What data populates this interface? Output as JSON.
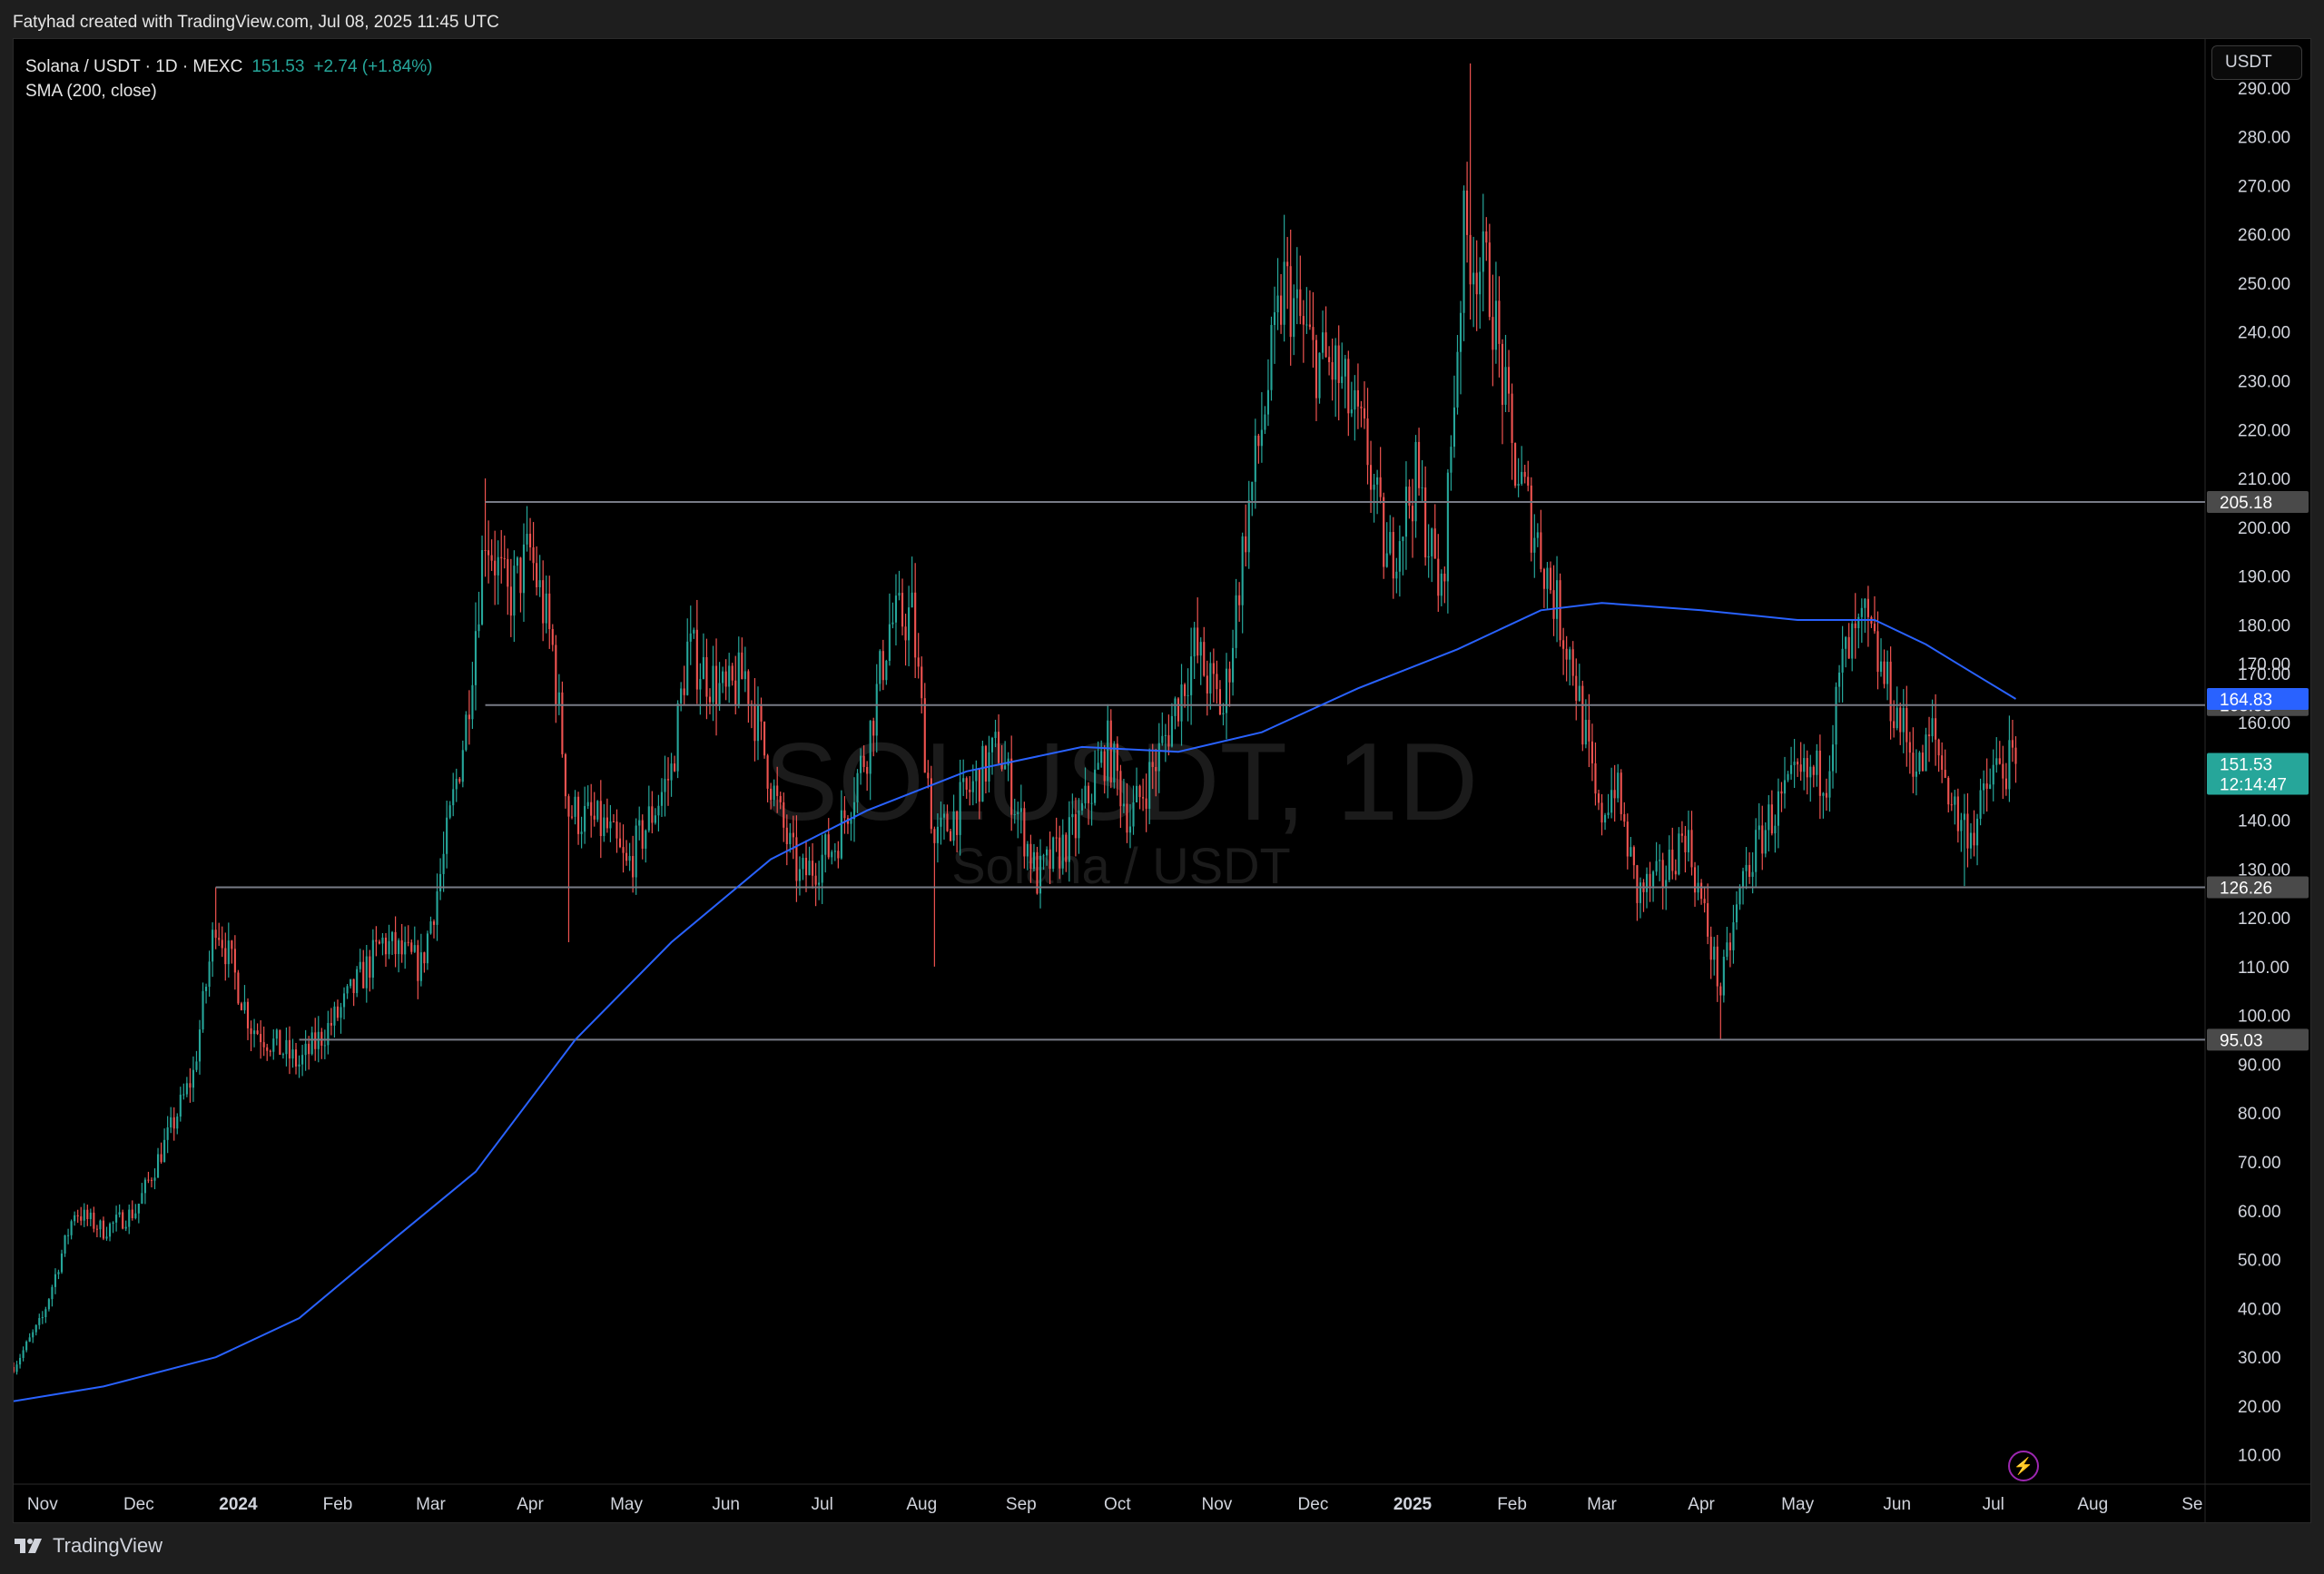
{
  "header": {
    "attribution": "Fatyhad created with TradingView.com, Jul 08, 2025 11:45 UTC"
  },
  "legend": {
    "symbol_line": "Solana / USDT · 1D · MEXC",
    "price": "151.53",
    "change": "+2.74 (+1.84%)",
    "indicator": "SMA (200, close)"
  },
  "toolbar": {
    "currency": "USDT"
  },
  "footer": {
    "brand": "TradingView"
  },
  "icons": {
    "flash": "lightning-icon",
    "logo": "tradingview-logo-icon"
  },
  "colors": {
    "up": "#26a69a",
    "down": "#ef5350",
    "sma": "#2962ff",
    "level": "#787b86",
    "price_badge": "#26a69a",
    "sma_badge": "#2962ff",
    "level_badge": "#4a4a4a"
  },
  "chart_data": {
    "type": "candlestick",
    "title": "Solana / USDT · 1D · MEXC",
    "watermark": {
      "title": "SOLUSDT, 1D",
      "subtitle": "Solana / USDT"
    },
    "x_range": [
      "2023-10-23",
      "2025-09-05"
    ],
    "y_range": [
      4,
      300
    ],
    "y_ticks": [
      10,
      20,
      30,
      40,
      50,
      60,
      70,
      80,
      90,
      100,
      110,
      120,
      130,
      140,
      150,
      160,
      170,
      180,
      190,
      200,
      210,
      220,
      230,
      240,
      250,
      260,
      270,
      280,
      290
    ],
    "x_ticks": [
      {
        "label": "Nov",
        "date": "2023-11-01",
        "bold": false
      },
      {
        "label": "Dec",
        "date": "2023-12-01",
        "bold": false
      },
      {
        "label": "2024",
        "date": "2024-01-01",
        "bold": true
      },
      {
        "label": "Feb",
        "date": "2024-02-01",
        "bold": false
      },
      {
        "label": "Mar",
        "date": "2024-03-01",
        "bold": false
      },
      {
        "label": "Apr",
        "date": "2024-04-01",
        "bold": false
      },
      {
        "label": "May",
        "date": "2024-05-01",
        "bold": false
      },
      {
        "label": "Jun",
        "date": "2024-06-01",
        "bold": false
      },
      {
        "label": "Jul",
        "date": "2024-07-01",
        "bold": false
      },
      {
        "label": "Aug",
        "date": "2024-08-01",
        "bold": false
      },
      {
        "label": "Sep",
        "date": "2024-09-01",
        "bold": false
      },
      {
        "label": "Oct",
        "date": "2024-10-01",
        "bold": false
      },
      {
        "label": "Nov",
        "date": "2024-11-01",
        "bold": false
      },
      {
        "label": "Dec",
        "date": "2024-12-01",
        "bold": false
      },
      {
        "label": "2025",
        "date": "2025-01-01",
        "bold": true
      },
      {
        "label": "Feb",
        "date": "2025-02-01",
        "bold": false
      },
      {
        "label": "Mar",
        "date": "2025-03-01",
        "bold": false
      },
      {
        "label": "Apr",
        "date": "2025-04-01",
        "bold": false
      },
      {
        "label": "May",
        "date": "2025-05-01",
        "bold": false
      },
      {
        "label": "Jun",
        "date": "2025-06-01",
        "bold": false
      },
      {
        "label": "Jul",
        "date": "2025-07-01",
        "bold": false
      },
      {
        "label": "Aug",
        "date": "2025-08-01",
        "bold": false
      },
      {
        "label": "Se",
        "date": "2025-09-01",
        "bold": false
      }
    ],
    "price_path": [
      [
        "2023-10-23",
        28
      ],
      [
        "2023-11-01",
        38
      ],
      [
        "2023-11-11",
        60
      ],
      [
        "2023-11-20",
        56
      ],
      [
        "2023-11-30",
        60
      ],
      [
        "2023-12-10",
        75
      ],
      [
        "2023-12-18",
        88
      ],
      [
        "2023-12-25",
        120
      ],
      [
        "2024-01-05",
        98
      ],
      [
        "2024-01-20",
        90
      ],
      [
        "2024-02-01",
        100
      ],
      [
        "2024-02-15",
        115
      ],
      [
        "2024-02-27",
        110
      ],
      [
        "2024-03-05",
        132
      ],
      [
        "2024-03-12",
        160
      ],
      [
        "2024-03-18",
        200
      ],
      [
        "2024-03-25",
        185
      ],
      [
        "2024-04-01",
        195
      ],
      [
        "2024-04-08",
        175
      ],
      [
        "2024-04-13",
        142
      ],
      [
        "2024-04-25",
        138
      ],
      [
        "2024-05-01",
        130
      ],
      [
        "2024-05-15",
        150
      ],
      [
        "2024-05-20",
        175
      ],
      [
        "2024-06-01",
        165
      ],
      [
        "2024-06-07",
        170
      ],
      [
        "2024-06-18",
        140
      ],
      [
        "2024-06-24",
        128
      ],
      [
        "2024-07-05",
        135
      ],
      [
        "2024-07-15",
        155
      ],
      [
        "2024-07-22",
        180
      ],
      [
        "2024-07-29",
        182
      ],
      [
        "2024-08-05",
        135
      ],
      [
        "2024-08-15",
        145
      ],
      [
        "2024-08-25",
        155
      ],
      [
        "2024-09-06",
        128
      ],
      [
        "2024-09-18",
        138
      ],
      [
        "2024-09-28",
        155
      ],
      [
        "2024-10-05",
        140
      ],
      [
        "2024-10-15",
        155
      ],
      [
        "2024-10-25",
        175
      ],
      [
        "2024-11-03",
        162
      ],
      [
        "2024-11-10",
        200
      ],
      [
        "2024-11-22",
        250
      ],
      [
        "2024-12-01",
        235
      ],
      [
        "2024-12-08",
        232
      ],
      [
        "2024-12-18",
        215
      ],
      [
        "2024-12-24",
        192
      ],
      [
        "2025-01-02",
        210
      ],
      [
        "2025-01-10",
        185
      ],
      [
        "2025-01-17",
        260
      ],
      [
        "2025-01-25",
        250
      ],
      [
        "2025-02-01",
        215
      ],
      [
        "2025-02-10",
        195
      ],
      [
        "2025-02-20",
        172
      ],
      [
        "2025-02-28",
        140
      ],
      [
        "2025-03-05",
        148
      ],
      [
        "2025-03-12",
        125
      ],
      [
        "2025-03-20",
        128
      ],
      [
        "2025-03-27",
        138
      ],
      [
        "2025-04-07",
        105
      ],
      [
        "2025-04-14",
        128
      ],
      [
        "2025-04-22",
        140
      ],
      [
        "2025-05-01",
        148
      ],
      [
        "2025-05-10",
        150
      ],
      [
        "2025-05-15",
        172
      ],
      [
        "2025-05-22",
        180
      ],
      [
        "2025-05-30",
        165
      ],
      [
        "2025-06-08",
        150
      ],
      [
        "2025-06-12",
        158
      ],
      [
        "2025-06-20",
        140
      ],
      [
        "2025-06-25",
        138
      ],
      [
        "2025-07-01",
        150
      ],
      [
        "2025-07-08",
        151.53
      ]
    ],
    "highlights": [
      {
        "date": "2023-12-25",
        "high": 126.26
      },
      {
        "date": "2024-03-18",
        "high": 210
      },
      {
        "date": "2024-04-13",
        "low": 115
      },
      {
        "date": "2024-07-29",
        "high": 194
      },
      {
        "date": "2024-08-05",
        "low": 110
      },
      {
        "date": "2024-11-22",
        "high": 264
      },
      {
        "date": "2025-01-19",
        "high": 295
      },
      {
        "date": "2025-04-07",
        "low": 95.03
      },
      {
        "date": "2025-05-23",
        "high": 188
      },
      {
        "date": "2025-06-22",
        "low": 126.5
      }
    ],
    "sma200": [
      [
        "2023-10-23",
        21
      ],
      [
        "2023-11-20",
        24
      ],
      [
        "2023-12-25",
        30
      ],
      [
        "2024-01-20",
        38
      ],
      [
        "2024-02-20",
        55
      ],
      [
        "2024-03-15",
        68
      ],
      [
        "2024-04-15",
        95
      ],
      [
        "2024-05-15",
        115
      ],
      [
        "2024-06-15",
        132
      ],
      [
        "2024-07-15",
        142
      ],
      [
        "2024-08-15",
        150
      ],
      [
        "2024-09-20",
        155
      ],
      [
        "2024-10-20",
        154
      ],
      [
        "2024-11-15",
        158
      ],
      [
        "2024-12-15",
        167
      ],
      [
        "2025-01-15",
        175
      ],
      [
        "2025-02-10",
        183
      ],
      [
        "2025-03-01",
        184.5
      ],
      [
        "2025-04-01",
        183
      ],
      [
        "2025-05-01",
        181
      ],
      [
        "2025-05-25",
        181
      ],
      [
        "2025-06-10",
        176
      ],
      [
        "2025-06-25",
        170
      ],
      [
        "2025-07-08",
        164.83
      ]
    ],
    "levels": [
      {
        "value": 205.18,
        "label": "205.18",
        "from": "2024-03-18"
      },
      {
        "value": 163.58,
        "label": "163.58",
        "from": "2024-03-18"
      },
      {
        "value": 126.26,
        "label": "126.26",
        "from": "2023-12-25"
      },
      {
        "value": 95.03,
        "label": "95.03",
        "from": "2024-01-20"
      }
    ],
    "last_price": {
      "value": 151.53,
      "label": "151.53",
      "countdown": "12:14:47"
    },
    "sma_last": {
      "value": 164.83,
      "label": "164.83"
    },
    "hidden_tick": "170.00"
  }
}
